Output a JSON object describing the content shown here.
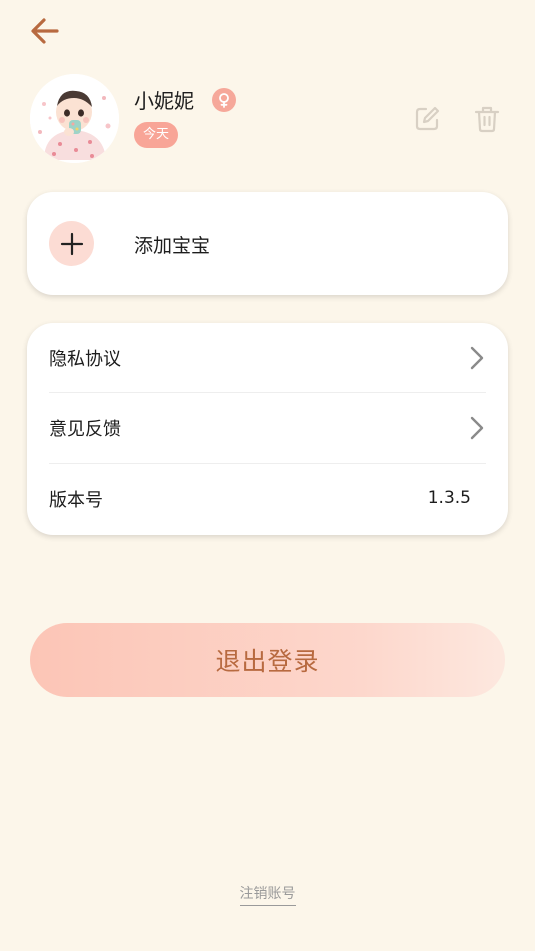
{
  "header": {
    "back_icon": "arrow-left-icon",
    "accent_color": "#b86a40"
  },
  "profile": {
    "name": "小妮妮",
    "gender_icon": "female-icon",
    "badge": "今天",
    "edit_icon": "edit-icon",
    "delete_icon": "trash-icon"
  },
  "add_baby": {
    "icon": "plus-icon",
    "label": "添加宝宝"
  },
  "menu": {
    "privacy": "隐私协议",
    "feedback": "意见反馈",
    "version_label": "版本号",
    "version_value": "1.3.5"
  },
  "logout_label": "退出登录",
  "cancel_account_label": "注销账号"
}
